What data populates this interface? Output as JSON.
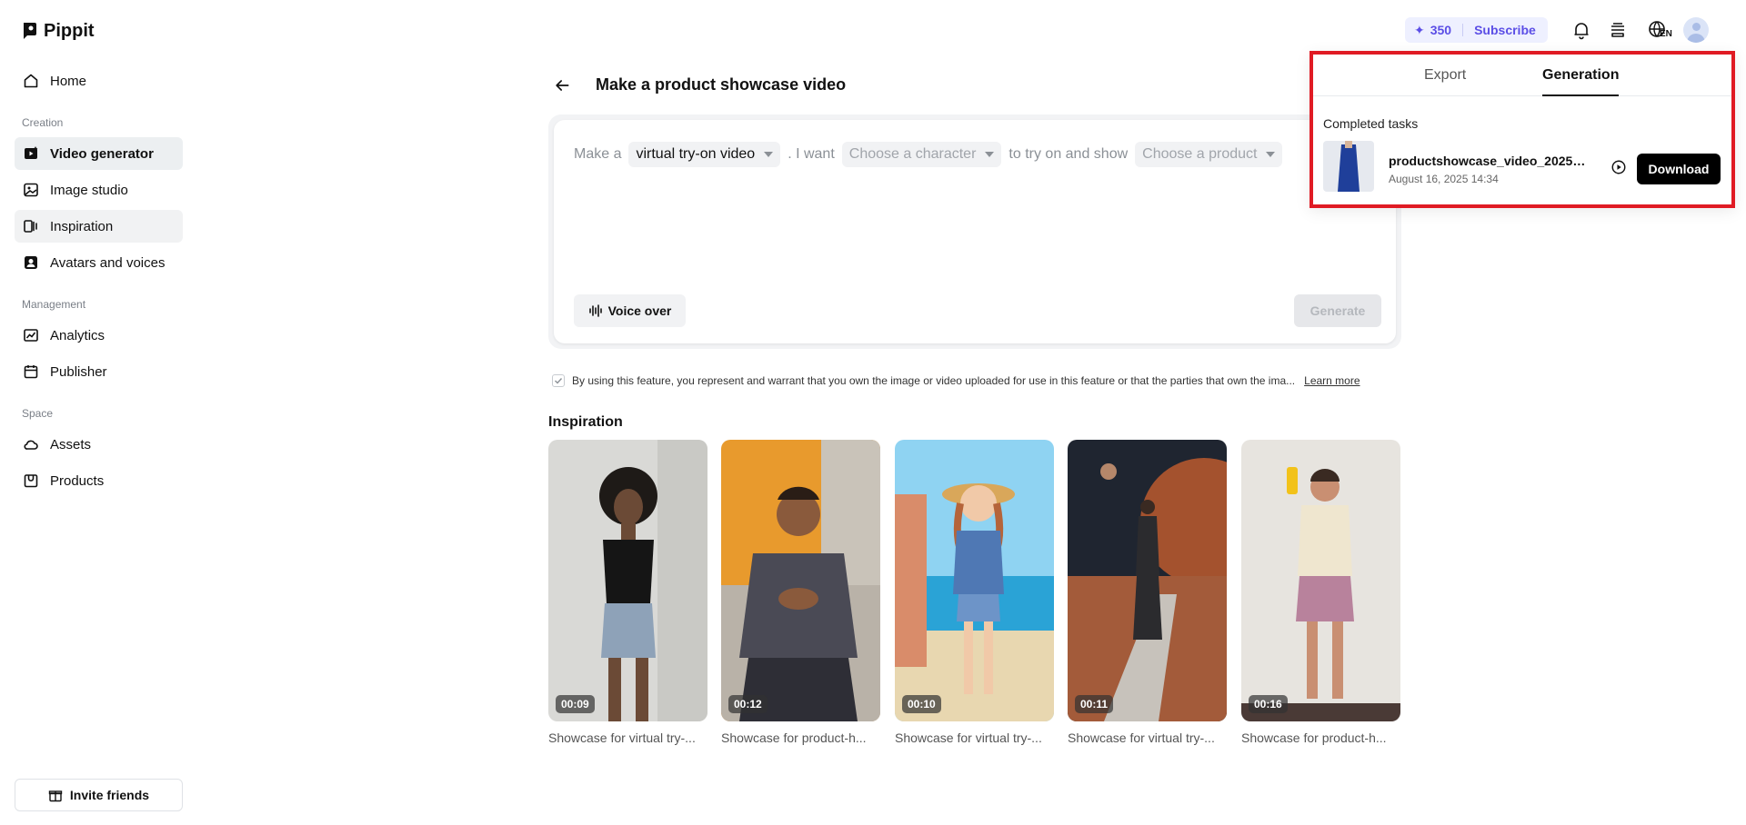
{
  "brand": {
    "name": "Pippit"
  },
  "sidebar": {
    "top_items": [
      {
        "label": "Home",
        "icon": "home-icon"
      }
    ],
    "sections": [
      {
        "label": "Creation"
      },
      {
        "label": "Management"
      },
      {
        "label": "Space"
      }
    ],
    "creation_items": [
      {
        "label": "Video generator",
        "icon": "video-generator-icon",
        "active": true
      },
      {
        "label": "Image studio",
        "icon": "image-studio-icon"
      },
      {
        "label": "Inspiration",
        "icon": "inspiration-icon"
      },
      {
        "label": "Avatars and voices",
        "icon": "avatar-icon"
      }
    ],
    "management_items": [
      {
        "label": "Analytics",
        "icon": "analytics-icon"
      },
      {
        "label": "Publisher",
        "icon": "calendar-icon"
      }
    ],
    "space_items": [
      {
        "label": "Assets",
        "icon": "cloud-icon"
      },
      {
        "label": "Products",
        "icon": "product-icon"
      }
    ],
    "invite_label": "Invite friends"
  },
  "topbar": {
    "credits": "350",
    "subscribe_label": "Subscribe",
    "language": "EN",
    "accent_color": "#5b4ee6"
  },
  "header": {
    "title": "Make a product showcase video"
  },
  "prompt": {
    "make_a": "Make a",
    "video_type": "virtual try-on video",
    "i_want": ". I want",
    "character_placeholder": "Choose a character",
    "to_try_on": "to try on and show",
    "product_placeholder": "Choose a product",
    "voice_over_label": "Voice over",
    "generate_label": "Generate"
  },
  "consent": {
    "text": "By using this feature, you represent and warrant that you own the image or video uploaded for use in this feature or that the parties that own the ima...",
    "learn_more": "Learn more"
  },
  "inspiration": {
    "title": "Inspiration",
    "items": [
      {
        "duration": "00:09",
        "caption": "Showcase for virtual try-..."
      },
      {
        "duration": "00:12",
        "caption": "Showcase for product-h..."
      },
      {
        "duration": "00:10",
        "caption": "Showcase for virtual try-..."
      },
      {
        "duration": "00:11",
        "caption": "Showcase for virtual try-..."
      },
      {
        "duration": "00:16",
        "caption": "Showcase for product-h..."
      }
    ]
  },
  "popover": {
    "tabs": [
      {
        "label": "Export"
      },
      {
        "label": "Generation",
        "active": true
      }
    ],
    "completed_label": "Completed tasks",
    "task": {
      "name": "productshowcase_video_20250...",
      "date": "August 16, 2025 14:34",
      "download_label": "Download"
    },
    "highlight_color": "#e01b24"
  }
}
